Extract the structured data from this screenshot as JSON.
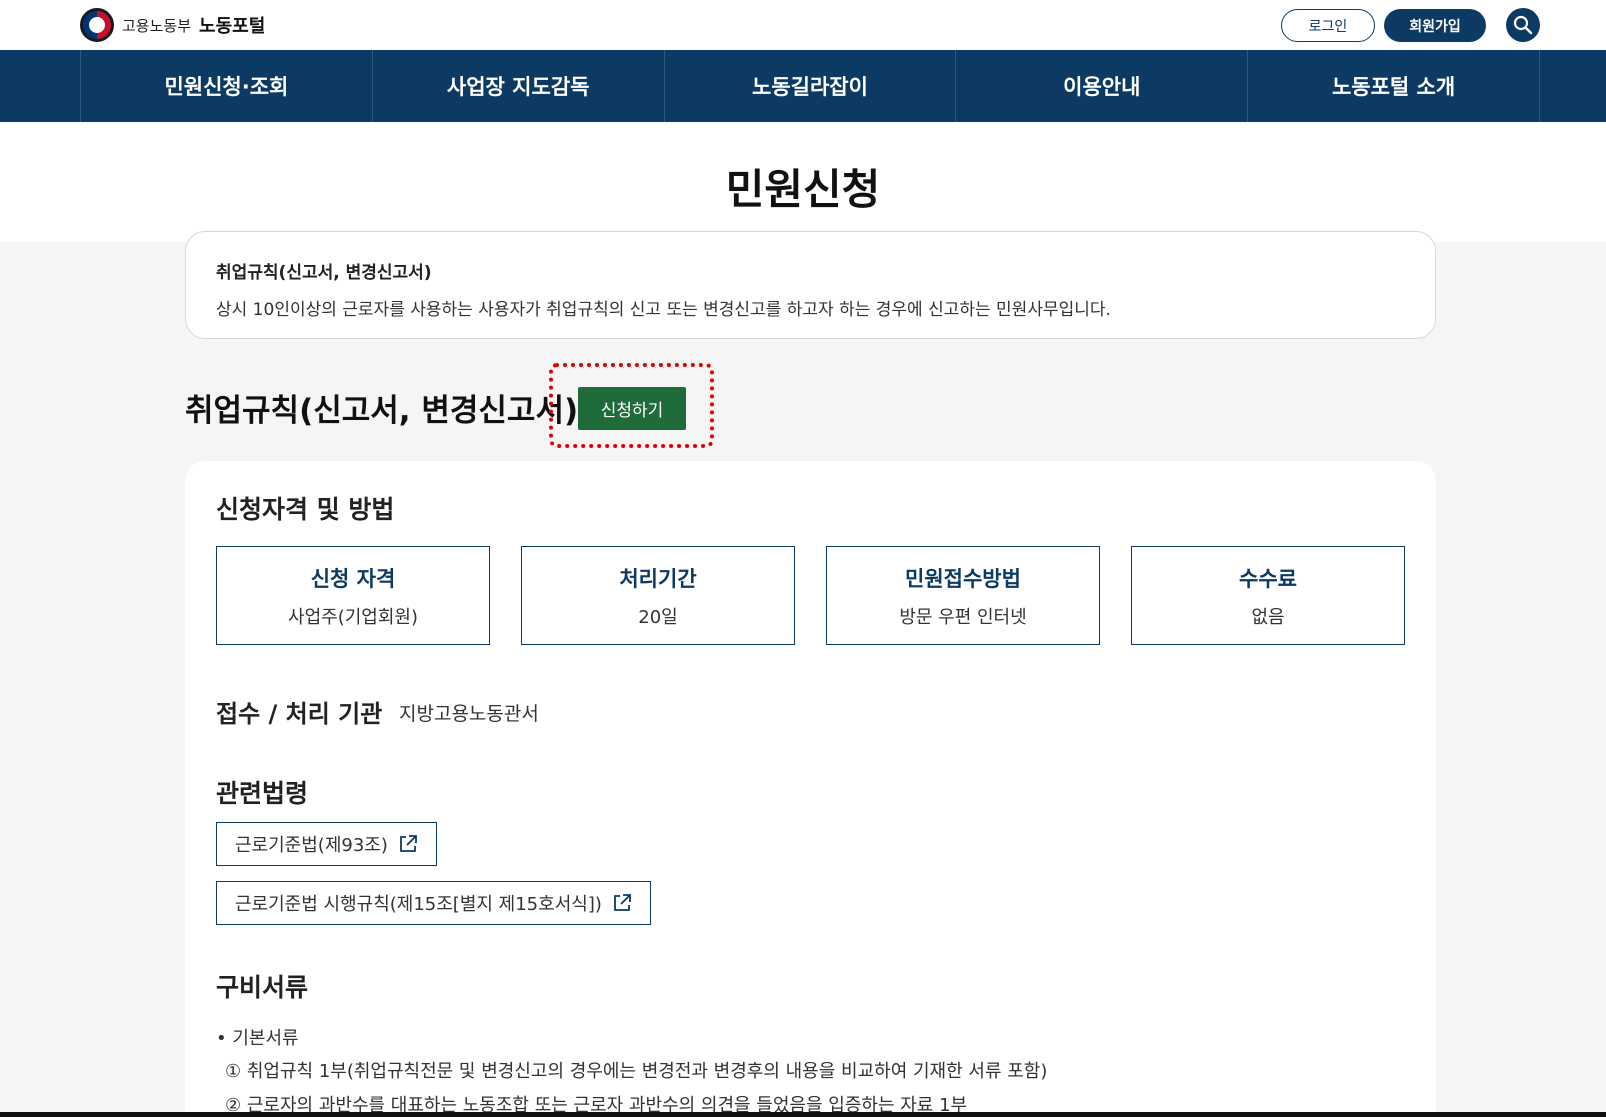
{
  "header": {
    "ministry": "고용노동부",
    "portal": "노동포털",
    "login_label": "로그인",
    "signup_label": "회원가입"
  },
  "nav": {
    "items": [
      {
        "label": "민원신청·조회"
      },
      {
        "label": "사업장 지도감독"
      },
      {
        "label": "노동길라잡이"
      },
      {
        "label": "이용안내"
      },
      {
        "label": "노동포털 소개"
      }
    ]
  },
  "page": {
    "title": "민원신청"
  },
  "summary": {
    "title": "취업규칙(신고서, 변경신고서)",
    "description": "상시 10인이상의 근로자를 사용하는 사용자가 취업규칙의 신고 또는 변경신고를 하고자 하는 경우에 신고하는 민원사무입니다."
  },
  "service": {
    "heading": "취업규칙(신고서, 변경신고서)",
    "apply_label": "신청하기"
  },
  "eligibility": {
    "heading": "신청자격 및 방법",
    "boxes": [
      {
        "label": "신청 자격",
        "value": "사업주(기업회원)"
      },
      {
        "label": "처리기간",
        "value": "20일"
      },
      {
        "label": "민원접수방법",
        "value": "방문 우편 인터넷"
      },
      {
        "label": "수수료",
        "value": "없음"
      }
    ]
  },
  "agency": {
    "label": "접수 / 처리 기관",
    "value": "지방고용노동관서"
  },
  "laws": {
    "heading": "관련법령",
    "items": [
      {
        "label": "근로기준법(제93조)"
      },
      {
        "label": "근로기준법 시행규칙(제15조[별지 제15호서식])"
      }
    ]
  },
  "documents": {
    "heading": "구비서류",
    "basic_label": "• 기본서류",
    "items": [
      "① 취업규칙 1부(취업규칙전문 및 변경신고의 경우에는 변경전과 변경후의 내용을 비교하여 기재한 서류 포함)",
      "② 근로자의 과반수를 대표하는 노동조합 또는 근로자 과반수의 의견을 들었음을 입증하는 자료 1부"
    ]
  },
  "colors": {
    "navy": "#0d3a63",
    "apply_green": "#1f6b3a",
    "highlight_red": "#e00000"
  }
}
